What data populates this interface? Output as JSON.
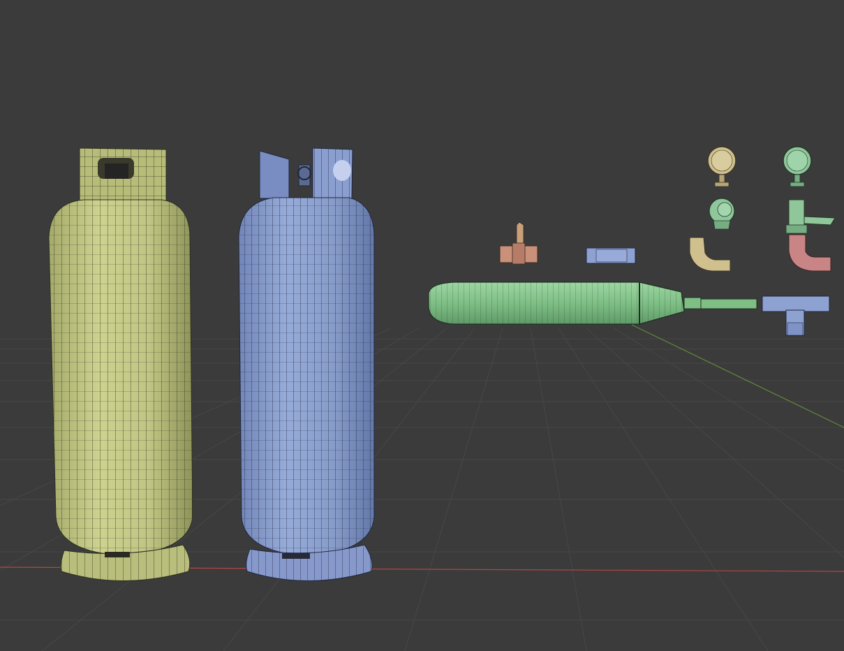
{
  "viewport": {
    "background": "#3b3b3b",
    "grid_color": "#474747",
    "x_axis_color": "#b24646",
    "y_axis_color": "#5f8a3c"
  },
  "objects": [
    {
      "name": "gas-cylinder-yellow",
      "color": "#c7cc86"
    },
    {
      "name": "gas-cylinder-blue",
      "color": "#8ea2d2"
    },
    {
      "name": "pressure-gauge-tan",
      "color": "#cfc08e"
    },
    {
      "name": "pressure-gauge-green",
      "color": "#8fc79a"
    },
    {
      "name": "regulator-valve-dial",
      "color": "#8fc79a"
    },
    {
      "name": "regulator-valve-handle",
      "color": "#8fc79a"
    },
    {
      "name": "ball-valve-copper",
      "color": "#c9907a"
    },
    {
      "name": "pipe-coupling-blue",
      "color": "#8ea2d2"
    },
    {
      "name": "elbow-pipe-tan",
      "color": "#cfc08e"
    },
    {
      "name": "elbow-pipe-red",
      "color": "#c98585"
    },
    {
      "name": "torch-burner-green",
      "color": "#7fbf86"
    },
    {
      "name": "tee-fitting-blue",
      "color": "#8ea2d2"
    }
  ]
}
